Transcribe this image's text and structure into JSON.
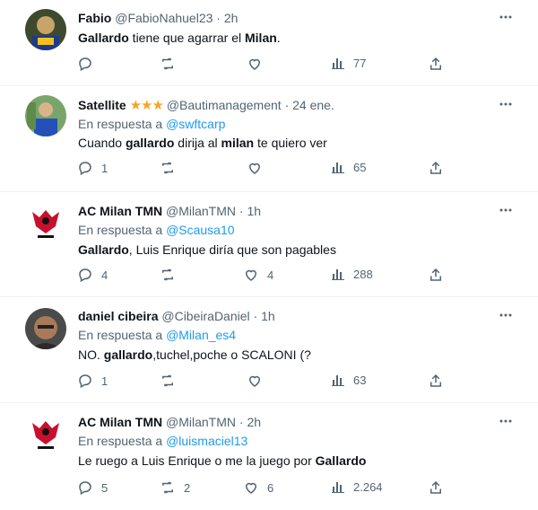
{
  "tweets": [
    {
      "name": "Fabio",
      "handle": "@FabioNahuel23",
      "sep": "·",
      "time": "2h",
      "reply_label": "",
      "reply_to": "",
      "text_parts": [
        "Gallardo",
        " tiene que agarrar el ",
        "Milan",
        "."
      ],
      "counts": {
        "reply": "",
        "retweet": "",
        "like": "",
        "views": "77"
      }
    },
    {
      "name": "Satellite",
      "badge": "★★★",
      "handle": "@Bautimanagement",
      "sep": "·",
      "time": "24 ene.",
      "reply_label": "En respuesta a",
      "reply_to": "@swftcarp",
      "text_parts": [
        "Cuando ",
        "gallardo",
        " dirija al ",
        "milan",
        " te quiero ver"
      ],
      "counts": {
        "reply": "1",
        "retweet": "",
        "like": "",
        "views": "65"
      }
    },
    {
      "name": "AC Milan TMN",
      "handle": "@MilanTMN",
      "sep": "·",
      "time": "1h",
      "reply_label": "En respuesta a",
      "reply_to": "@Scausa10",
      "text_parts": [
        "Gallardo",
        ", Luis Enrique diría que son pagables"
      ],
      "counts": {
        "reply": "4",
        "retweet": "",
        "like": "4",
        "views": "288"
      }
    },
    {
      "name": "daniel cibeira",
      "handle": "@CibeiraDaniel",
      "sep": "·",
      "time": "1h",
      "reply_label": "En respuesta a",
      "reply_to": "@Milan_es4",
      "text_parts": [
        "NO. ",
        "gallardo",
        ",tuchel,poche o SCALONI (?"
      ],
      "counts": {
        "reply": "1",
        "retweet": "",
        "like": "",
        "views": "63"
      }
    },
    {
      "name": "AC Milan TMN",
      "handle": "@MilanTMN",
      "sep": "·",
      "time": "2h",
      "reply_label": "En respuesta a",
      "reply_to": "@luismaciel13",
      "text_parts": [
        "Le ruego a Luis Enrique o me la juego por ",
        "Gallardo"
      ],
      "counts": {
        "reply": "5",
        "retweet": "2",
        "like": "6",
        "views": "2.264"
      }
    }
  ],
  "colors": {
    "link": "#1d9bf0",
    "muted": "#536471",
    "text": "#0f1419",
    "star": "#f5a623"
  },
  "icons": [
    "reply-icon",
    "retweet-icon",
    "like-icon",
    "views-icon",
    "share-icon",
    "more-icon"
  ]
}
